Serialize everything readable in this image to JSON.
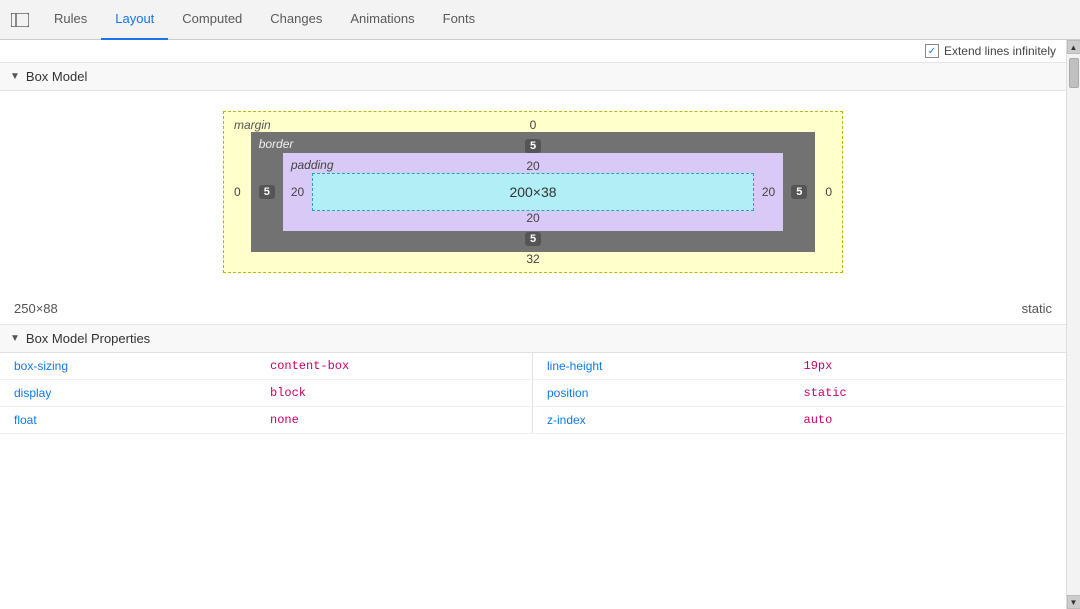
{
  "nav": {
    "tabs": [
      {
        "label": "Rules",
        "active": false
      },
      {
        "label": "Layout",
        "active": true
      },
      {
        "label": "Computed",
        "active": false
      },
      {
        "label": "Changes",
        "active": false
      },
      {
        "label": "Animations",
        "active": false
      },
      {
        "label": "Fonts",
        "active": false
      }
    ],
    "toggle_icon": "panel-icon"
  },
  "extend_lines": {
    "label": "Extend lines infinitely",
    "checked": true
  },
  "box_model_section": {
    "title": "Box Model",
    "margin_label": "margin",
    "border_label": "border",
    "padding_label": "padding",
    "margin_top": "0",
    "margin_bottom": "32",
    "margin_left": "0",
    "margin_right": "0",
    "border_top": "5",
    "border_bottom": "5",
    "border_left": "5",
    "border_right": "5",
    "padding_top": "20",
    "padding_bottom": "20",
    "padding_left": "20",
    "padding_right": "20",
    "content_size": "200×38"
  },
  "dimensions": {
    "size": "250×88",
    "position": "static"
  },
  "box_model_properties": {
    "title": "Box Model Properties",
    "left_props": [
      {
        "name": "box-sizing",
        "value": "content-box"
      },
      {
        "name": "display",
        "value": "block"
      },
      {
        "name": "float",
        "value": "none"
      }
    ],
    "right_props": [
      {
        "name": "line-height",
        "value": "19px"
      },
      {
        "name": "position",
        "value": "static"
      },
      {
        "name": "z-index",
        "value": "auto"
      }
    ]
  }
}
